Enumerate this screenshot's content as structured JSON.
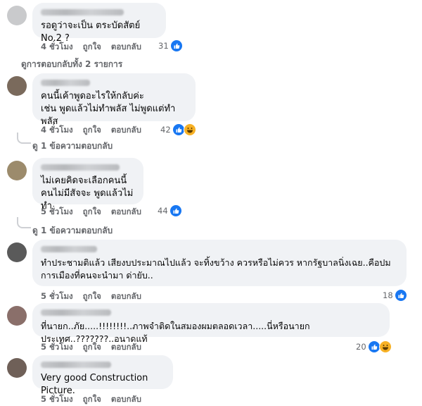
{
  "comments": [
    {
      "text": "รอดูว่าจะเป็น ตระบัดสัตย์ No.2 ?",
      "time": "4 ชั่วโมง",
      "like_label": "ถูกใจ",
      "reply_label": "ตอบกลับ",
      "reaction_count": "31",
      "reactions": [
        "like-icon"
      ],
      "replies_link": "ดูการตอบกลับทั้ง 2 รายการ",
      "avatar_color": "#c9cacc"
    },
    {
      "text": "คนนี้เค้าพูดอะไรให้กลับค่ะ\nเช่น พูดแล้วไม่ทำพลัส ไม่พูดแต่ทำพลัส",
      "time": "4 ชั่วโมง",
      "like_label": "ถูกใจ",
      "reply_label": "ตอบกลับ",
      "reaction_count": "42",
      "reactions": [
        "like-icon",
        "haha-icon"
      ],
      "replies_link": "ดู 1 ข้อความตอบกลับ",
      "avatar_color": "#7a6a5c"
    },
    {
      "text": "ไม่เคยคิดจะเลือกคนนี้\nคนไม่มีสัจจะ พูดแล้วไม่ทำ",
      "time": "5 ชั่วโมง",
      "like_label": "ถูกใจ",
      "reply_label": "ตอบกลับ",
      "reaction_count": "44",
      "reactions": [
        "like-icon"
      ],
      "replies_link": "ดู 1 ข้อความตอบกลับ",
      "avatar_color": "#9c8b6c"
    },
    {
      "text": "ทำประชามติแล้ว เสียงบประมาณไปแล้ว จะทิ้งขว้าง ควรหรือไม่ควร หากรัฐบาลนิ่งเฉย..คือปม\nการเมืองที่คนจะนำมา ด่ายับ..",
      "time": "5 ชั่วโมง",
      "like_label": "ถูกใจ",
      "reply_label": "ตอบกลับ",
      "reaction_count": "18",
      "reactions": [
        "like-icon"
      ],
      "replies_link": "",
      "avatar_color": "#5a5a5a"
    },
    {
      "text": "ที่นายก..ภัย.....!!!!!!!!..ภาพจำติดในสมองผมตลอดเวลา.....นี่หรือนายกประเทศ..???????..อนาดแท้",
      "time": "5 ชั่วโมง",
      "like_label": "ถูกใจ",
      "reply_label": "ตอบกลับ",
      "reaction_count": "20",
      "reactions": [
        "like-icon",
        "haha-icon"
      ],
      "replies_link": "",
      "avatar_color": "#8a6f6a"
    },
    {
      "text": "Very good Construction Picture.",
      "time": "5 ชั่วโมง",
      "like_label": "ถูกใจ",
      "reply_label": "ตอบกลับ",
      "reaction_count": "",
      "reactions": [],
      "replies_link": "",
      "avatar_color": "#6f6058"
    }
  ]
}
